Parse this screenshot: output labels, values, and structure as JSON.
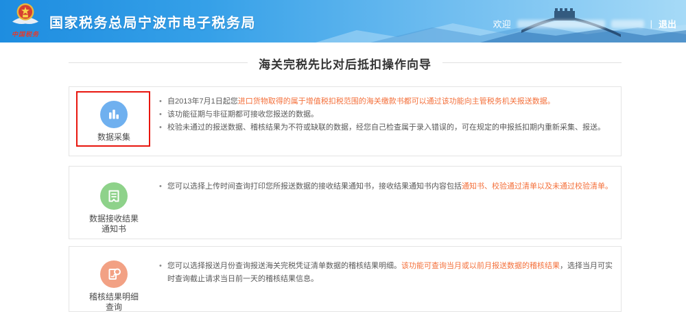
{
  "colors": {
    "header_gradient_start": "#1e8de0",
    "header_gradient_end": "#a6daf7",
    "accent_orange_text": "#f4703b",
    "body_text_gray": "#595959",
    "highlight_red": "#e8150d",
    "section_border": "#e4e4e4"
  },
  "header": {
    "title": "国家税务总局宁波市电子税务局",
    "emblem_caption": "中国税务",
    "welcome_label": "欢迎",
    "divider": "|",
    "logout_label": "退出"
  },
  "page": {
    "title": "海关完税先比对后抵扣操作向导"
  },
  "sections": [
    {
      "label": "数据采集",
      "icon": "bar-chart-icon",
      "circle_color": "#6fb0ef",
      "highlighted": true,
      "bullets": [
        [
          {
            "text": "自2013年7月1日起您",
            "color": "gray"
          },
          {
            "text": "进口货物取得的属于增值税扣税范围的海关缴款书都可以通过该功能向主管税务机关报送数据。",
            "color": "orange"
          }
        ],
        [
          {
            "text": "该功能征期与非征期都可接收您报送的数据。",
            "color": "gray"
          }
        ],
        [
          {
            "text": "校验未通过的报送数据、稽核结果为不符或缺联的数据，经您自己检查属于录入错误的，可在规定的申报抵扣期内重新采集、报送。",
            "color": "gray"
          }
        ]
      ]
    },
    {
      "label": "数据接收结果通知书",
      "icon": "receipt-icon",
      "circle_color": "#8ed28a",
      "highlighted": false,
      "bullets": [
        [
          {
            "text": "您可以选择上传时间查询打印您所报送数据的接收结果通知书，接收结果通知书内容包括",
            "color": "gray"
          },
          {
            "text": "通知书、校验通过清单以及未通过校验清单。",
            "color": "orange"
          }
        ]
      ]
    },
    {
      "label": "稽核结果明细查询",
      "icon": "document-search-icon",
      "circle_color": "#f2a184",
      "highlighted": false,
      "bullets": [
        [
          {
            "text": "您可以选择报送月份查询报送海关完税凭证清单数据的稽核结果明细。",
            "color": "gray"
          },
          {
            "text": "该功能可查询当月或以前月报送数据的稽核结果",
            "color": "orange"
          },
          {
            "text": "，选择当月可实时查询截止请求当日前一天的稽核结果信息。",
            "color": "gray"
          }
        ]
      ]
    }
  ]
}
